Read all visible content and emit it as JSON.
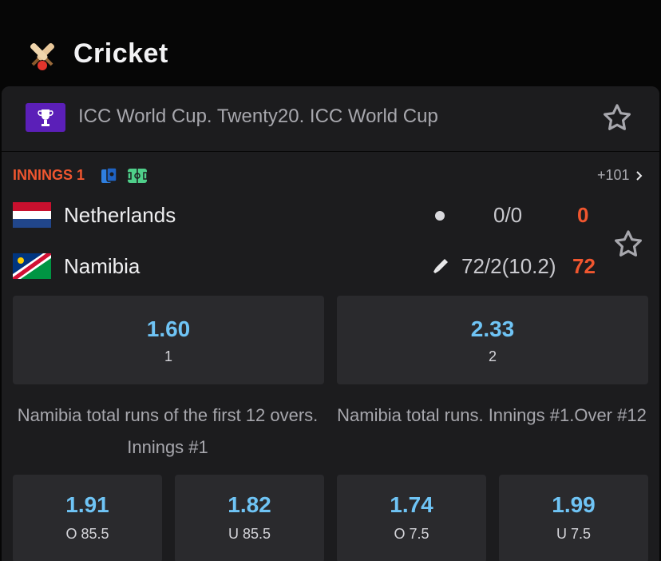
{
  "header": {
    "title": "Cricket",
    "icon": "cricket-bat-ball-icon"
  },
  "league": {
    "name": "ICC World Cup. Twenty20. ICC World Cup",
    "favorite_icon": "star-outline-icon"
  },
  "match": {
    "status": "INNINGS 1",
    "more_markets": "+101",
    "teams": [
      {
        "name": "Netherlands",
        "detail": "0/0",
        "score": "0",
        "indicator": "ball-dot-icon"
      },
      {
        "name": "Namibia",
        "detail": "72/2(10.2)",
        "score": "72",
        "indicator": "bat-icon"
      }
    ]
  },
  "main_odds": [
    {
      "value": "1.60",
      "label": "1"
    },
    {
      "value": "2.33",
      "label": "2"
    }
  ],
  "markets": [
    {
      "title": "Namibia total runs of the first 12 overs. Innings #1",
      "odds": [
        {
          "value": "1.91",
          "label": "O 85.5"
        },
        {
          "value": "1.82",
          "label": "U 85.5"
        }
      ]
    },
    {
      "title": "Namibia total runs. Innings #1.Over #12",
      "odds": [
        {
          "value": "1.74",
          "label": "O 7.5"
        },
        {
          "value": "1.99",
          "label": "U 7.5"
        }
      ]
    }
  ],
  "colors": {
    "accent_odds": "#6fc4f5",
    "live_red": "#f0562f",
    "card_bg": "#1c1c1e",
    "odd_bg": "#2a2a2d"
  }
}
